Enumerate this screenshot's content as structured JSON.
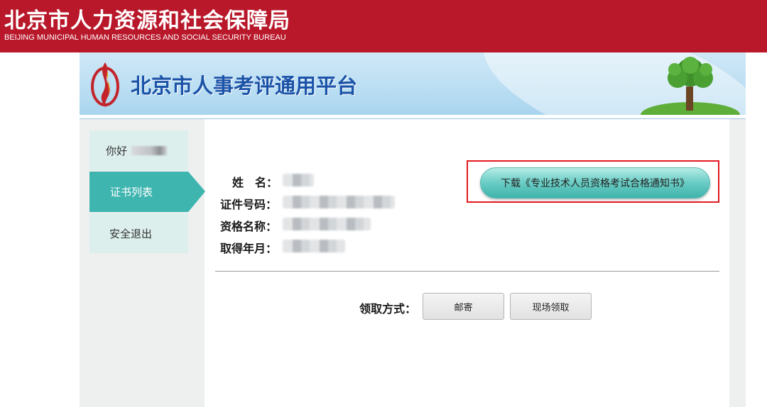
{
  "bureau": {
    "name_cn": "北京市人力资源和社会保障局",
    "name_en": "BEIJING MUNICIPAL HUMAN RESOURCES AND SOCIAL SECURITY BUREAU"
  },
  "platform": {
    "title": "北京市人事考评通用平台"
  },
  "sidebar": {
    "greeting": "你好",
    "items": [
      {
        "label": "证书列表",
        "active": true
      },
      {
        "label": "安全退出",
        "active": false
      }
    ]
  },
  "certificate": {
    "fields": [
      {
        "label": "姓　名："
      },
      {
        "label": "证件号码："
      },
      {
        "label": "资格名称："
      },
      {
        "label": "取得年月："
      }
    ],
    "download_label": "下载《专业技术人员资格考试合格通知书》"
  },
  "pickup": {
    "label": "领取方式：",
    "options": [
      "邮寄",
      "现场领取"
    ]
  },
  "colors": {
    "bureau_red": "#b8182a",
    "accent_teal": "#3fb5b0",
    "highlight_red": "#e2191f",
    "title_blue": "#1b53a8"
  }
}
